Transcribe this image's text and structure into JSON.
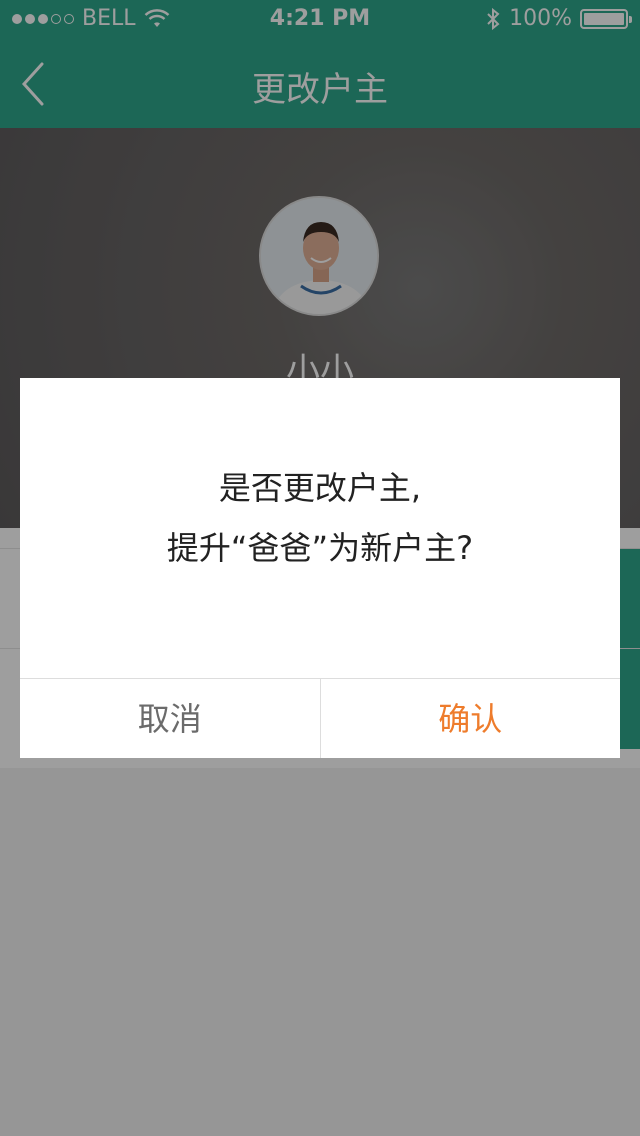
{
  "status_bar": {
    "carrier": "BELL",
    "time": "4:21 PM",
    "battery": "100%",
    "signal_filled": 3,
    "signal_total": 5
  },
  "nav": {
    "title": "更改户主"
  },
  "profile": {
    "name": "小小"
  },
  "dialog": {
    "line1": "是否更改户主,",
    "line2": "提升“爸爸”为新户主?",
    "cancel_label": "取消",
    "confirm_label": "确认"
  },
  "colors": {
    "primary": "#2ea68b",
    "confirm": "#ee7c2c",
    "cancel": "#6b6b6b"
  }
}
